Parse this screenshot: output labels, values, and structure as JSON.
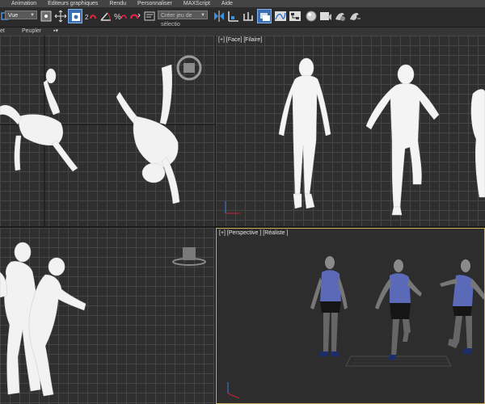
{
  "menu": [
    "Animation",
    "Editeurs graphiques",
    "Rendu",
    "Personnaliser",
    "MAXScript",
    "Aide"
  ],
  "toolbar": {
    "view_select": "Vue",
    "selection_set_placeholder": "Créer jeu de sélectio"
  },
  "subbar": {
    "left_label": "et",
    "populate_label": "Peupler"
  },
  "viewports": {
    "front": "[+] [Face] [Filaire]",
    "perspective": "[+] [Perspective ] [Réaliste ]"
  },
  "colors": {
    "accent": "#3d6fb0",
    "active_viewport_border": "#c9b35a"
  }
}
